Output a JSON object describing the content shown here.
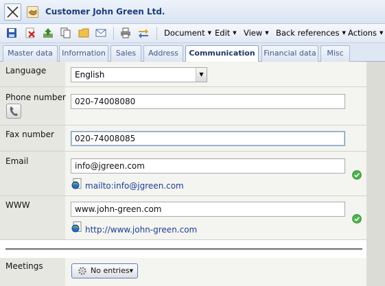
{
  "window": {
    "title": "Customer John Green Ltd."
  },
  "toolbar": {
    "menus": [
      "Document",
      "Edit",
      "View",
      "Back references",
      "Actions"
    ]
  },
  "tabs": [
    {
      "label": "Master data"
    },
    {
      "label": "Information"
    },
    {
      "label": "Sales"
    },
    {
      "label": "Address"
    },
    {
      "label": "Communication",
      "active": true
    },
    {
      "label": "Financial data"
    },
    {
      "label": "Misc"
    }
  ],
  "form": {
    "language": {
      "label": "Language",
      "value": "English"
    },
    "phone": {
      "label": "Phone number",
      "value": "020-74008080"
    },
    "fax": {
      "label": "Fax number",
      "value": "020-74008085"
    },
    "email": {
      "label": "Email",
      "value": "info@jgreen.com",
      "link": "mailto:info@jgreen.com"
    },
    "www": {
      "label": "WWW",
      "value": "www.john-green.com",
      "link": "http://www.john-green.com"
    },
    "meetings": {
      "label": "Meetings",
      "button": "No entries"
    }
  },
  "colors": {
    "accent": "#1d3d7a",
    "link": "#1a3d96",
    "ok": "#3aa53a"
  }
}
